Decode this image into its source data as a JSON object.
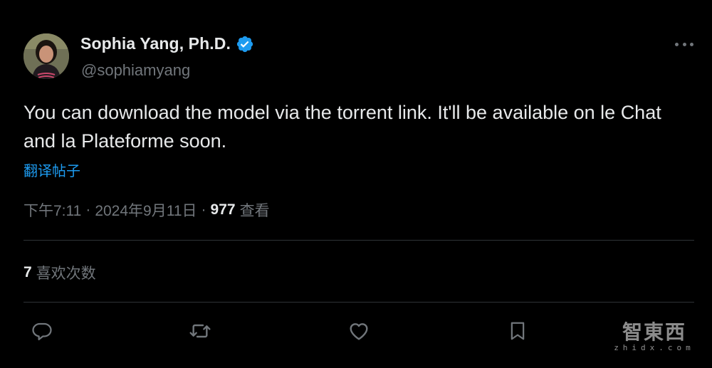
{
  "author": {
    "display_name": "Sophia Yang, Ph.D.",
    "handle": "@sophiamyang",
    "verified": true
  },
  "tweet": {
    "text": "You can download the model via the torrent link. It'll be available on le Chat and la Plateforme soon.",
    "translate_label": "翻译帖子",
    "time": "下午7:11",
    "separator": "·",
    "date": "2024年9月11日",
    "views_count": "977",
    "views_label": "查看"
  },
  "stats": {
    "likes_count": "7",
    "likes_label": "喜欢次数"
  },
  "actions": [
    {
      "name": "reply",
      "icon": "reply-icon"
    },
    {
      "name": "retweet",
      "icon": "retweet-icon"
    },
    {
      "name": "like",
      "icon": "heart-icon"
    },
    {
      "name": "bookmark",
      "icon": "bookmark-icon"
    }
  ],
  "watermark": {
    "main": "智東西",
    "sub": "zhidx.com"
  },
  "colors": {
    "background": "#000000",
    "text": "#e7e9ea",
    "secondary": "#71767b",
    "link": "#1d9bf0",
    "verified": "#1d9bf0",
    "divider": "#2f3336"
  }
}
